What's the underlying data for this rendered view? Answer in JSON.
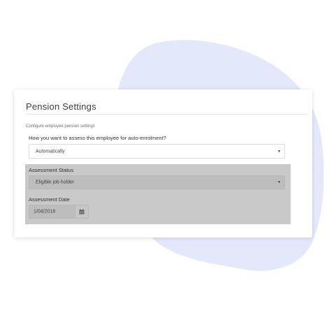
{
  "colors": {
    "background": "#ffffff",
    "blob": "#e3e9fb",
    "card": "#ffffff",
    "shaded_section": "#c9c9c9",
    "disabled_field": "#bdbdbd"
  },
  "card": {
    "title": "Pension Settings",
    "description": "Configure employee pension settings",
    "assessment_method": {
      "label": "How you want to assess this employee for auto-enrolment?",
      "value": "Automatically",
      "caret_icon": "caret-down-icon"
    },
    "assessment_status": {
      "label": "Assessment Status",
      "value": "Eligible job holder",
      "caret_icon": "caret-down-icon"
    },
    "assessment_date": {
      "label": "Assessment Date",
      "value": "1/04/2018",
      "button_icon": "calendar-icon"
    }
  }
}
